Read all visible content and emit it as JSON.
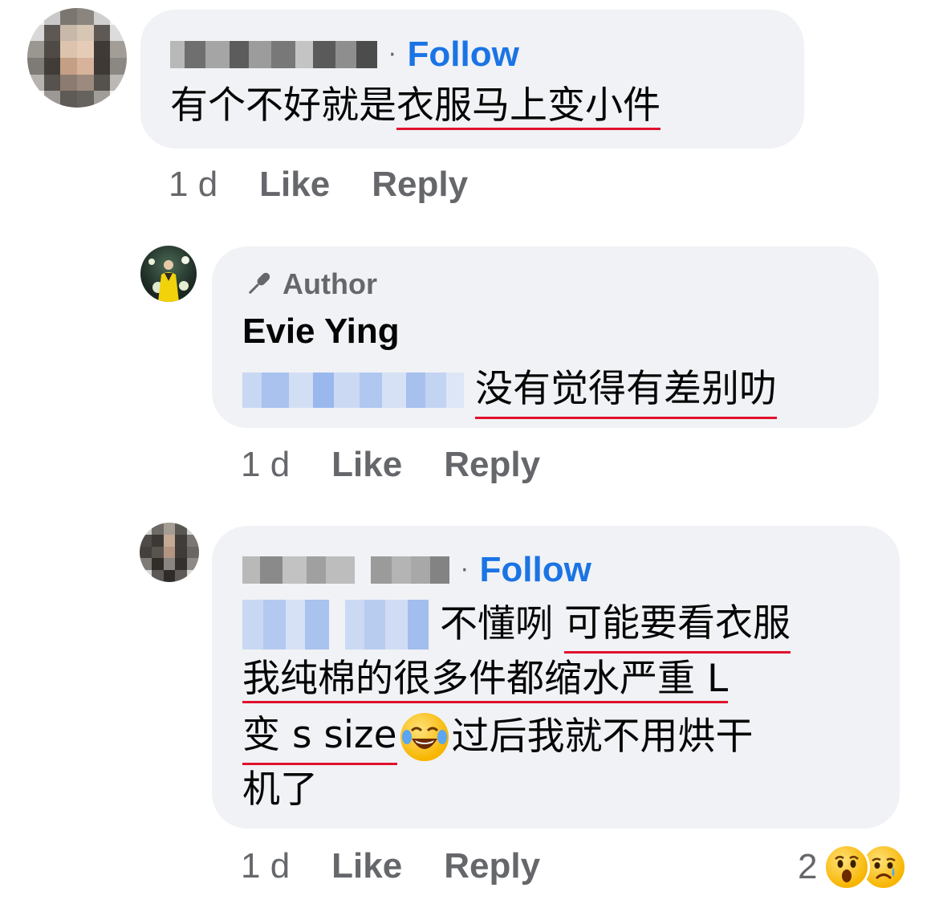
{
  "comments": [
    {
      "author_hidden": true,
      "follow_label": "Follow",
      "separator": "·",
      "text_plain": "有个不好就是",
      "text_underlined": "衣服马上变小件",
      "time": "1 d",
      "like_label": "Like",
      "reply_label": "Reply"
    },
    {
      "badge": "Author",
      "author": "Evie Ying",
      "text": "没有觉得有差别叻",
      "time": "1 d",
      "like_label": "Like",
      "reply_label": "Reply"
    },
    {
      "follow_label": "Follow",
      "separator": "·",
      "line1_plain": "不懂咧 ",
      "line1_underlined": "可能要看衣服",
      "line2_underlined": "我纯棉的很多件都缩水严重 L",
      "line3_underlined": "变 s size",
      "line3_rest": "过后我就不用烘干",
      "line4": "机了",
      "time": "1 d",
      "like_label": "Like",
      "reply_label": "Reply",
      "reaction_count": "2"
    }
  ],
  "icons": {
    "author_badge": "microphone-icon",
    "emoji_inline": "tears-of-joy-emoji",
    "reactions": [
      "wow-reaction-icon",
      "sad-reaction-icon"
    ]
  },
  "colors": {
    "link": "#1b74e4",
    "bubble": "#f0f2f5",
    "meta": "#65676b",
    "spell_underline": "#e0112b"
  }
}
